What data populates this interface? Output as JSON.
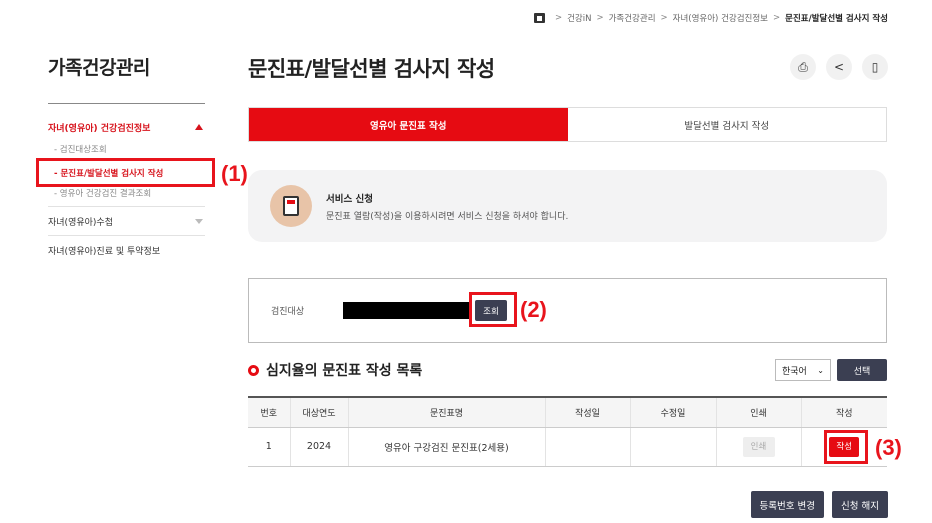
{
  "breadcrumb": [
    "건강iN",
    "가족건강관리",
    "자녀(영유아) 건강검진정보",
    "문진표/발달선별 검사지 작성"
  ],
  "sidebar": {
    "title": "가족건강관리",
    "section": "자녀(영유아) 건강검진정보",
    "subitems": [
      {
        "label": "- 검진대상조회"
      },
      {
        "label": "- 문진표/발달선별 검사지 작성"
      },
      {
        "label": "- 영유아 건강검진 결과조회"
      }
    ],
    "items": [
      {
        "label": "자녀(영유아)수첩"
      },
      {
        "label": "자녀(영유아)진료 및 투약정보"
      }
    ]
  },
  "page": {
    "title": "문진표/발달선별 검사지 작성"
  },
  "tools": [
    "print-icon",
    "share-icon",
    "bookmark-icon"
  ],
  "tabs": [
    {
      "label": "영유아 문진표 작성",
      "active": true
    },
    {
      "label": "발달선별 검사지 작성",
      "active": false
    }
  ],
  "service": {
    "title": "서비스 신청",
    "desc": "문진표 열람(작성)을 이용하시려면 서비스 신청을 하셔야 합니다."
  },
  "search": {
    "label": "검진대상",
    "button": "조회"
  },
  "list": {
    "title": "심지율의 문진표 작성 목록",
    "language": "한국어",
    "select_button": "선택",
    "columns": [
      "번호",
      "대상연도",
      "문진표명",
      "작성일",
      "수정일",
      "인쇄",
      "작성"
    ],
    "rows": [
      {
        "no": "1",
        "year": "2024",
        "name": "영유아 구강검진 문진표(2세용)",
        "created": "",
        "modified": "",
        "print": "인쇄",
        "write": "작성"
      }
    ]
  },
  "bottom_buttons": {
    "change": "등록번호 변경",
    "cancel": "신청 해지"
  },
  "callouts": [
    "(1)",
    "(2)",
    "(3)"
  ],
  "colors": {
    "accent": "#e60b12",
    "highlight": "#e8141c",
    "dark_button": "#3b3f52"
  }
}
